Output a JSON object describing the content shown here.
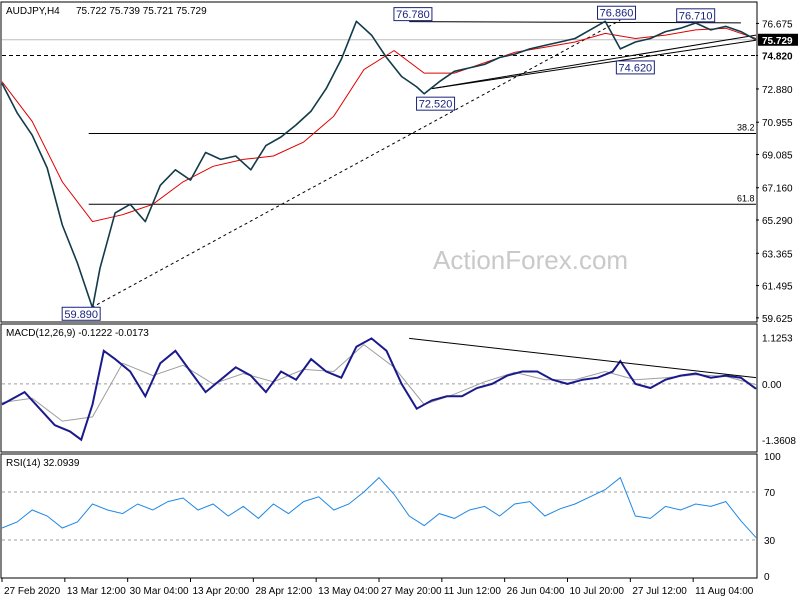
{
  "chart_data": {
    "type": "line",
    "header": {
      "symbol": "AUDJPY,H4",
      "ohlc": "75.722 75.739 75.721 75.729"
    },
    "watermark": "ActionForex.com",
    "price_axis": {
      "ticks": [
        "76.675",
        "74.820",
        "72.880",
        "70.955",
        "69.085",
        "67.160",
        "65.290",
        "63.365",
        "61.495",
        "59.625"
      ],
      "tick_values": [
        76.675,
        74.82,
        72.88,
        70.955,
        69.085,
        67.16,
        65.29,
        63.365,
        61.495,
        59.625
      ],
      "range": [
        59.5,
        77.8
      ],
      "current_price_label": "75.729",
      "current_price": 75.729,
      "level_label": "74.820",
      "level": 74.82
    },
    "x_labels": [
      "27 Feb 2020",
      "13 Mar 12:00",
      "30 Mar 04:00",
      "13 Apr 20:00",
      "28 Apr 12:00",
      "13 May 04:00",
      "27 May 20:00",
      "11 Jun 12:00",
      "26 Jun 04:00",
      "10 Jul 20:00",
      "27 Jul 12:00",
      "11 Aug 04:00"
    ],
    "x_range": [
      0,
      100
    ],
    "price_series": {
      "x": [
        0,
        2,
        4,
        6,
        8,
        10,
        12,
        13,
        15,
        17,
        19,
        21,
        23,
        25,
        27,
        29,
        31,
        33,
        35,
        37,
        39,
        41,
        43,
        45,
        47,
        49,
        51,
        53,
        55,
        56,
        58,
        60,
        62,
        64,
        66,
        68,
        70,
        72,
        74,
        76,
        78,
        80,
        82,
        84,
        86,
        88,
        90,
        92,
        94,
        96,
        98,
        100
      ],
      "y": [
        73.2,
        71.5,
        70.2,
        68.3,
        65.0,
        62.8,
        60.2,
        62.5,
        65.7,
        66.2,
        65.2,
        67.3,
        68.2,
        67.6,
        69.2,
        68.8,
        69.0,
        68.2,
        69.6,
        70.1,
        70.8,
        71.6,
        72.9,
        74.6,
        76.8,
        76.0,
        74.7,
        73.6,
        73.0,
        72.6,
        73.3,
        73.9,
        74.1,
        74.3,
        74.7,
        74.9,
        75.2,
        75.4,
        75.6,
        75.8,
        76.3,
        76.8,
        75.2,
        75.6,
        75.8,
        76.2,
        76.4,
        76.7,
        76.3,
        76.5,
        76.2,
        75.729
      ]
    },
    "ma_series": {
      "x": [
        0,
        4,
        8,
        12,
        16,
        20,
        24,
        28,
        32,
        36,
        40,
        44,
        48,
        52,
        56,
        60,
        64,
        68,
        72,
        76,
        80,
        84,
        88,
        92,
        96,
        100
      ],
      "y": [
        73.3,
        71.0,
        67.5,
        65.2,
        65.6,
        66.2,
        67.5,
        68.4,
        68.8,
        69.0,
        69.8,
        71.3,
        74.0,
        75.1,
        73.8,
        73.8,
        74.4,
        75.0,
        75.3,
        75.6,
        76.1,
        75.8,
        76.0,
        76.3,
        76.4,
        75.8
      ]
    },
    "trendlines": [
      {
        "x1": 10.5,
        "y1": 59.89,
        "x2": 82,
        "y2": 76.86,
        "style": "dotted"
      },
      {
        "x1": 57,
        "y1": 72.9,
        "x2": 100,
        "y2": 76.0,
        "style": "solid"
      },
      {
        "x1": 57,
        "y1": 72.9,
        "x2": 100,
        "y2": 75.7,
        "style": "solid"
      },
      {
        "x1": 54,
        "y1": 76.78,
        "x2": 98,
        "y2": 76.71,
        "style": "solid"
      }
    ],
    "fib_levels": [
      {
        "label": "38.2",
        "value": 70.3
      },
      {
        "label": "61.8",
        "value": 66.2
      }
    ],
    "price_labels": [
      {
        "text": "76.780",
        "x": 54.5,
        "value": 76.78
      },
      {
        "text": "76.860",
        "x": 81.5,
        "value": 76.86
      },
      {
        "text": "76.710",
        "x": 92,
        "value": 76.71
      },
      {
        "text": "74.620",
        "x": 84,
        "value": 74.62
      },
      {
        "text": "72.520",
        "x": 57.5,
        "value": 72.52
      },
      {
        "text": "59.890",
        "x": 10.5,
        "value": 59.89
      }
    ],
    "macd": {
      "header": "MACD(12,26,9) -0.1222 -0.0173",
      "ticks": [
        "1.1253",
        "0.00",
        "-1.3608"
      ],
      "tick_values": [
        1.1253,
        0.0,
        -1.3608
      ],
      "range": [
        -1.6,
        1.4
      ],
      "macd_line": {
        "x": [
          0,
          3,
          5,
          7,
          9,
          10.5,
          12,
          13.5,
          15,
          17,
          19,
          21,
          23,
          25,
          27,
          29,
          31,
          33,
          35,
          37,
          39,
          41,
          43,
          45,
          47,
          49,
          51,
          53,
          55,
          57,
          59,
          61,
          63,
          65,
          67,
          69,
          71,
          73,
          75,
          77,
          79,
          81,
          82,
          84,
          86,
          88,
          90,
          92,
          94,
          96,
          98,
          100
        ],
        "y": [
          -0.5,
          -0.2,
          -0.6,
          -1.0,
          -1.15,
          -1.35,
          -0.5,
          0.8,
          0.6,
          0.3,
          -0.3,
          0.5,
          0.8,
          0.3,
          -0.2,
          0.1,
          0.4,
          0.2,
          -0.2,
          0.3,
          0.1,
          0.6,
          0.3,
          0.15,
          0.9,
          1.1,
          0.8,
          0.0,
          -0.6,
          -0.4,
          -0.3,
          -0.3,
          -0.1,
          0.0,
          0.2,
          0.3,
          0.3,
          0.1,
          0.0,
          0.1,
          0.15,
          0.3,
          0.55,
          0.0,
          -0.1,
          0.1,
          0.2,
          0.25,
          0.15,
          0.2,
          0.15,
          -0.12
        ]
      },
      "signal_line": {
        "x": [
          0,
          4,
          8,
          12,
          16,
          20,
          24,
          28,
          32,
          36,
          40,
          44,
          48,
          52,
          56,
          60,
          64,
          68,
          72,
          76,
          80,
          84,
          88,
          92,
          96,
          100
        ],
        "y": [
          -0.45,
          -0.35,
          -0.9,
          -0.8,
          0.5,
          0.2,
          0.45,
          0.0,
          0.25,
          0.05,
          0.35,
          0.3,
          0.95,
          0.4,
          -0.5,
          -0.25,
          0.05,
          0.28,
          0.1,
          0.1,
          0.3,
          0.1,
          0.15,
          0.22,
          0.18,
          -0.02
        ]
      },
      "trendline": {
        "x1": 54,
        "y1": 1.1,
        "x2": 100,
        "y2": 0.15
      }
    },
    "rsi": {
      "header": "RSI(14) 32.0939",
      "ticks": [
        "100",
        "70",
        "30",
        "0"
      ],
      "tick_values": [
        100,
        70,
        30,
        0
      ],
      "range": [
        0,
        100
      ],
      "levels": [
        70,
        30
      ],
      "line": {
        "x": [
          0,
          2,
          4,
          6,
          8,
          10,
          12,
          14,
          16,
          18,
          20,
          22,
          24,
          26,
          28,
          30,
          32,
          34,
          36,
          38,
          40,
          42,
          44,
          46,
          48,
          50,
          52,
          54,
          56,
          58,
          60,
          62,
          64,
          66,
          68,
          70,
          72,
          74,
          76,
          78,
          80,
          82,
          84,
          86,
          88,
          90,
          92,
          94,
          96,
          98,
          100
        ],
        "y": [
          40,
          45,
          55,
          50,
          40,
          45,
          60,
          55,
          52,
          60,
          55,
          62,
          65,
          55,
          60,
          50,
          58,
          48,
          60,
          52,
          62,
          66,
          55,
          60,
          70,
          82,
          68,
          50,
          42,
          52,
          48,
          55,
          58,
          50,
          60,
          62,
          50,
          56,
          60,
          66,
          72,
          82,
          50,
          48,
          58,
          55,
          60,
          58,
          62,
          46,
          32
        ]
      }
    }
  }
}
